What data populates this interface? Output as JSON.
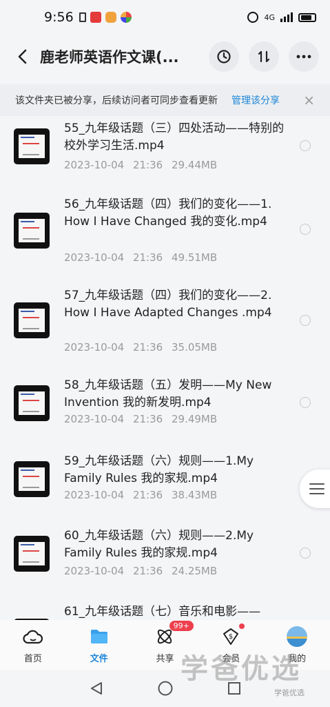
{
  "status_bar": {
    "time": "9:56",
    "network": "4G"
  },
  "header": {
    "title": "鹿老师英语作文课(..."
  },
  "share_banner": {
    "text": "该文件夹已被分享，后续访问者可同步查看更新",
    "manage_link": "管理该分享",
    "close": "×"
  },
  "files": [
    {
      "name": "55_九年级话题（三）四处活动——特别的校外学习生活.mp4",
      "date": "2023-10-04",
      "time": "21:36",
      "size": "29.44MB"
    },
    {
      "name": "56_九年级话题（四）我们的变化——1. How I Have Changed 我的变化.mp4",
      "date": "2023-10-04",
      "time": "21:36",
      "size": "49.51MB"
    },
    {
      "name": "57_九年级话题（四）我们的变化——2. How I Have Adapted Changes .mp4",
      "date": "2023-10-04",
      "time": "21:36",
      "size": "35.05MB"
    },
    {
      "name": "58_九年级话题（五）发明——My New Invention 我的新发明.mp4",
      "date": "2023-10-04",
      "time": "21:36",
      "size": "29.49MB"
    },
    {
      "name": "59_九年级话题（六）规则——1.My Family Rules 我的家规.mp4",
      "date": "2023-10-04",
      "time": "21:36",
      "size": "38.43MB"
    },
    {
      "name": "60_九年级话题（六）规则——2.My Family Rules 我的家规.mp4",
      "date": "2023-10-04",
      "time": "21:36",
      "size": "24.25MB"
    },
    {
      "name": "61_九年级话题（七）音乐和电影——",
      "date": "",
      "time": "",
      "size": ""
    }
  ],
  "bottom_nav": [
    {
      "label": "首页",
      "icon": "cloud-home-icon"
    },
    {
      "label": "文件",
      "icon": "folder-icon"
    },
    {
      "label": "共享",
      "icon": "share-atom-icon",
      "badge": "99+"
    },
    {
      "label": "会员",
      "icon": "vip-dollar-icon"
    },
    {
      "label": "我的",
      "icon": "avatar"
    }
  ],
  "watermark": {
    "main": "学爸优选",
    "small": "学爸优选"
  },
  "colors": {
    "accent": "#1f86d9",
    "badge": "#ee3f4d"
  }
}
